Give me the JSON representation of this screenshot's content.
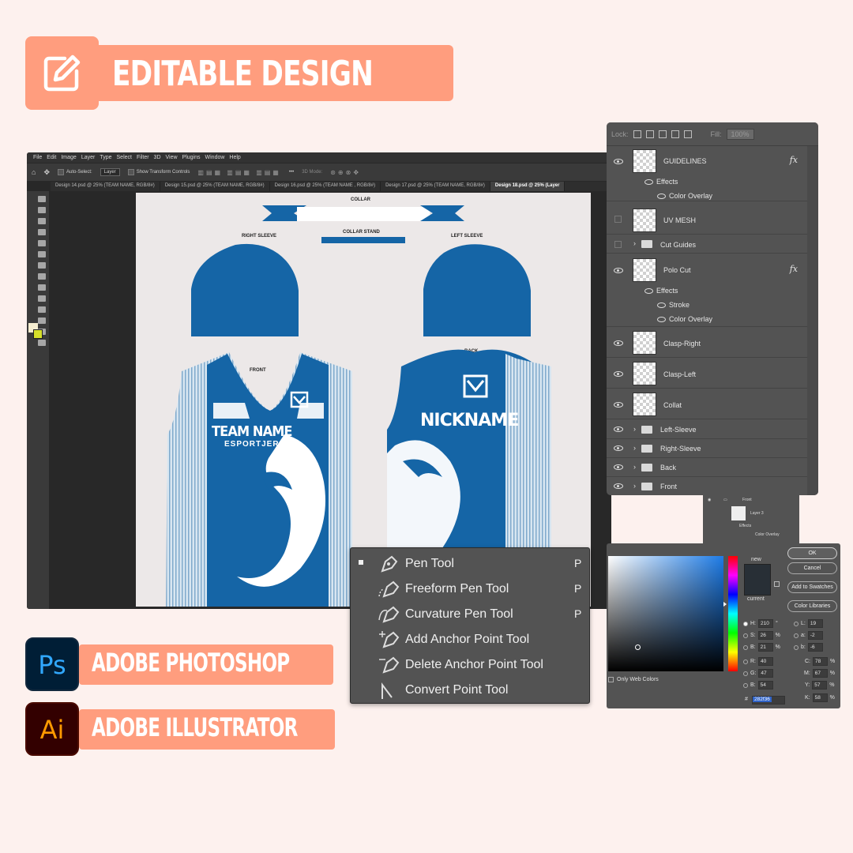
{
  "header": {
    "title": "EDITABLE DESIGN",
    "icon": "edit-icon"
  },
  "photoshop": {
    "menu": [
      "File",
      "Edit",
      "Image",
      "Layer",
      "Type",
      "Select",
      "Filter",
      "3D",
      "View",
      "Plugins",
      "Window",
      "Help"
    ],
    "options": {
      "auto_select": "Auto-Select:",
      "auto_select_value": "Layer",
      "show_transform": "Show Transform Controls",
      "mode_3d": "3D Mode:"
    },
    "tabs": [
      "Design 14.psd @ 25% (TEAM NAME, RGB/8#)",
      "Design 15.psd @ 25% (TEAM NAME, RGB/8#)",
      "Design 16.psd @ 25% (TEAM NAME , RGB/8#)",
      "Design 17.psd @ 25% (TEAM NAME, RGB/8#)",
      "Design 18.psd @ 25% (Layer"
    ],
    "canvas": {
      "collar": "COLLAR",
      "collar_stand": "COLLAR STAND",
      "right_sleeve": "RIGHT SLEEVE",
      "left_sleeve": "LEFT SLEEVE",
      "front": "FRONT",
      "back": "BACK",
      "team_name": "TEAM NAME",
      "subtitle": "ESPORTJERSEY",
      "nickname": "NICKNAME",
      "jersey_color": "#1565a6"
    }
  },
  "layers": {
    "lock_label": "Lock:",
    "fill_label": "Fill:",
    "fill_value": "100%",
    "rows": {
      "guidelines": "GUIDELINES",
      "guidelines_effects": "Effects",
      "guidelines_color_overlay": "Color Overlay",
      "uv_mesh": "UV MESH",
      "cut_guides": "Cut Guides",
      "polo_cut": "Polo Cut",
      "polo_effects": "Effects",
      "polo_stroke": "Stroke",
      "polo_color_overlay": "Color Overlay",
      "clasp_right": "Clasp-Right",
      "clasp_left": "Clasp-Left",
      "collat": "Collat",
      "left_sleeve": "Left-Sleeve",
      "right_sleeve": "Right-Sleeve",
      "back": "Back",
      "front": "Front"
    },
    "fx": "fx",
    "mini": {
      "front": "Front",
      "layer3": "Layer 3",
      "effects": "Effects",
      "color_overlay": "Color Overlay"
    }
  },
  "pen_menu": {
    "items": [
      {
        "label": "Pen Tool",
        "key": "P",
        "icon": "pen-icon"
      },
      {
        "label": "Freeform Pen Tool",
        "key": "P",
        "icon": "freeform-pen-icon"
      },
      {
        "label": "Curvature Pen Tool",
        "key": "P",
        "icon": "curvature-pen-icon"
      },
      {
        "label": "Add Anchor Point Tool",
        "key": "",
        "icon": "add-anchor-icon"
      },
      {
        "label": "Delete Anchor Point Tool",
        "key": "",
        "icon": "delete-anchor-icon"
      },
      {
        "label": "Convert Point Tool",
        "key": "",
        "icon": "convert-point-icon"
      }
    ]
  },
  "color_picker": {
    "new_label": "new",
    "current_label": "current",
    "ok": "OK",
    "cancel": "Cancel",
    "add_to_swatches": "Add to Swatches",
    "color_libraries": "Color Libraries",
    "only_web_colors": "Only Web Colors",
    "H": "210",
    "S": "26",
    "B": "21",
    "R": "40",
    "G": "47",
    "Bv": "54",
    "L": "19",
    "a": "-2",
    "b": "-6",
    "C": "78",
    "M": "67",
    "Y": "57",
    "K": "58",
    "hex_label": "#",
    "hex": "282f36",
    "selected_color": "#282f36"
  },
  "badges": {
    "photoshop": {
      "app": "Ps",
      "label": "ADOBE PHOTOSHOP"
    },
    "illustrator": {
      "app": "Ai",
      "label": "ADOBE ILLUSTRATOR"
    }
  }
}
